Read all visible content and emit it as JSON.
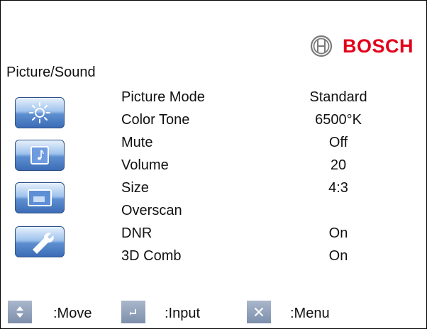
{
  "brand": {
    "name": "BOSCH",
    "color": "#e2001a"
  },
  "menu": {
    "title": "Picture/Sound",
    "categories": [
      {
        "icon": "brightness-icon"
      },
      {
        "icon": "music-note-icon"
      },
      {
        "icon": "screen-size-icon"
      },
      {
        "icon": "wrench-icon"
      }
    ],
    "items": [
      {
        "label": "Picture Mode",
        "value": "Standard"
      },
      {
        "label": "Color Tone",
        "value": "6500°K"
      },
      {
        "label": "Mute",
        "value": "Off"
      },
      {
        "label": "Volume",
        "value": "20"
      },
      {
        "label": "Size",
        "value": "4:3"
      },
      {
        "label": "Overscan",
        "value": ""
      },
      {
        "label": "DNR",
        "value": "On"
      },
      {
        "label": "3D Comb",
        "value": "On"
      }
    ]
  },
  "footer": {
    "move": {
      "icon": "up-down-arrows-icon",
      "label": ":Move"
    },
    "input": {
      "icon": "enter-icon",
      "label": ":Input"
    },
    "menu": {
      "icon": "close-icon",
      "label": ":Menu"
    }
  },
  "colors": {
    "icon_gradient_top": "#e8f1fc",
    "icon_gradient_bottom": "#3b6cb6",
    "key_background": "#8e9fba"
  }
}
